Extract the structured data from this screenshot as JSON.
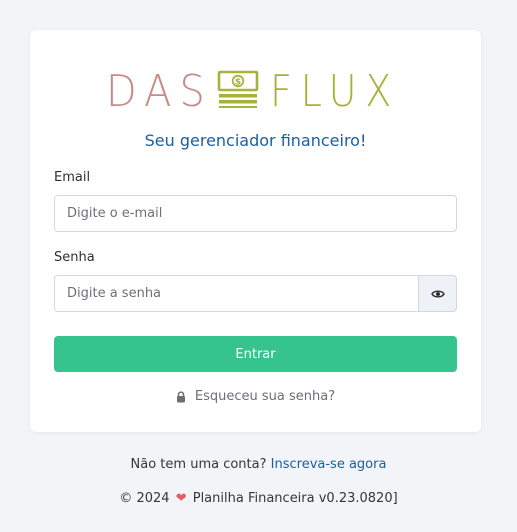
{
  "logo": {
    "word_left": "DAS",
    "word_right": "FLUX",
    "icon": "money-stack-icon",
    "colors": {
      "left": "#c98a87",
      "right": "#a7b23a",
      "icon": "#a7b23a"
    }
  },
  "subtitle": "Seu gerenciador financeiro!",
  "form": {
    "email_label": "Email",
    "email_placeholder": "Digite o e-mail",
    "password_label": "Senha",
    "password_placeholder": "Digite a senha",
    "toggle_icon": "eye-icon",
    "submit_label": "Entrar",
    "forgot_label": "Esqueceu sua senha?",
    "forgot_icon": "lock-icon"
  },
  "signup": {
    "prompt": "Não tem uma conta?",
    "link": "Inscreva-se agora"
  },
  "footer": {
    "copyright": "© 2024",
    "heart_icon": "heart-icon",
    "text": "Planilha Financeira v0.23.0820]"
  },
  "colors": {
    "accent": "#35c48d",
    "link": "#1b5fa1",
    "background": "#f3f4f7",
    "heart": "#e35d6a"
  }
}
